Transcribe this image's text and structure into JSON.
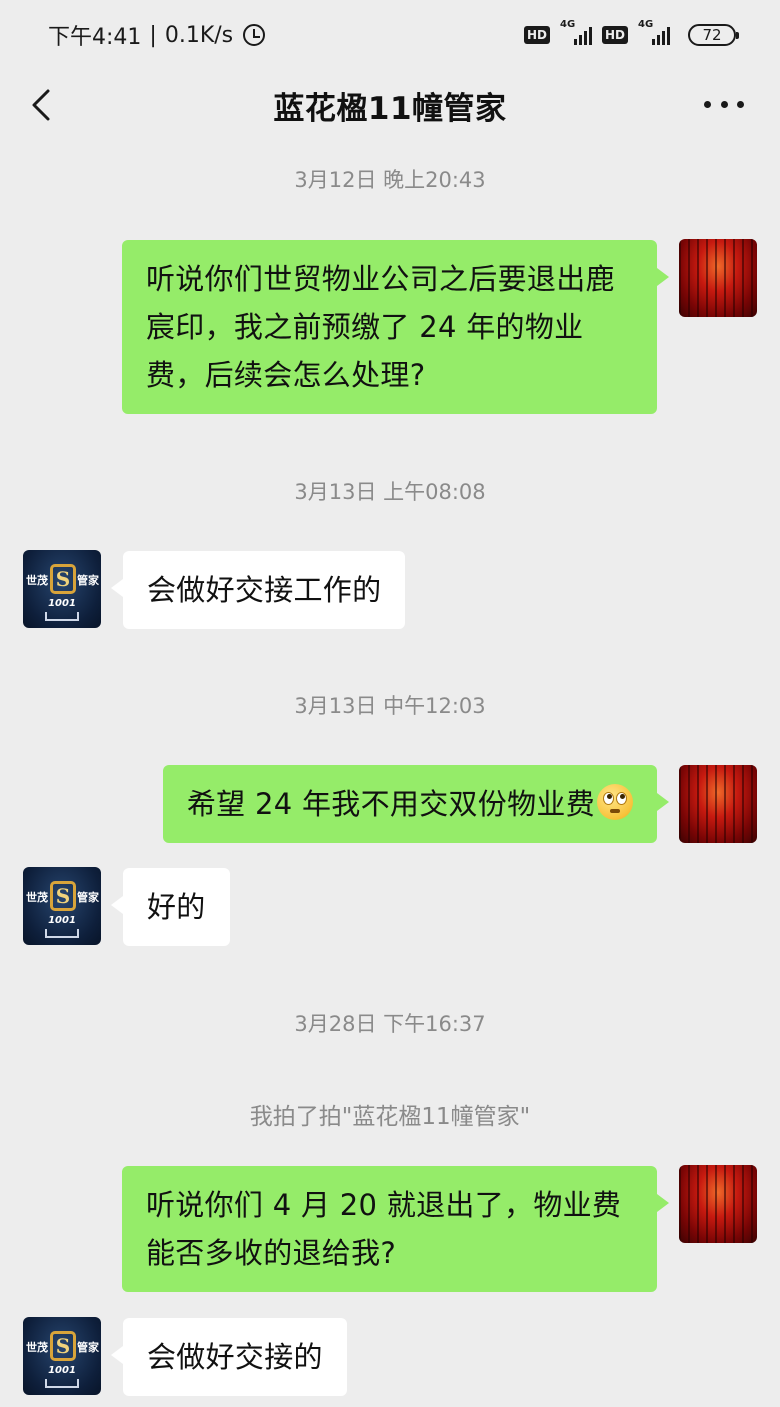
{
  "status_bar": {
    "time": "下午4:41",
    "speed": "0.1K/s",
    "hd1": "HD",
    "hd2": "HD",
    "net1": "4G",
    "net2": "4G",
    "battery": "72"
  },
  "header": {
    "title": "蓝花楹11幢管家"
  },
  "messages": {
    "ts1": "3月12日 晚上20:43",
    "m1": "听说你们世贸物业公司之后要退出鹿宸印，我之前预缴了 24 年的物业费，后续会怎么处理?",
    "ts2": "3月13日 上午08:08",
    "m2": "会做好交接工作的",
    "ts3": "3月13日 中午12:03",
    "m3": "希望 24 年我不用交双份物业费",
    "m3_emoji": "rolling-eyes-emoji",
    "m4": "好的",
    "ts4": "3月28日 下午16:37",
    "sys1": "我拍了拍\"蓝花楹11幢管家\"",
    "m5": "听说你们 4 月 20 就退出了，物业费能否多收的退给我?",
    "m6": "会做好交接的"
  },
  "other_avatar": {
    "logo_left": "世茂",
    "logo_right": "管家",
    "logo_letter": "S",
    "logo_number": "1001"
  },
  "colors": {
    "background": "#ededed",
    "self_bubble": "#95ec69",
    "other_bubble": "#ffffff",
    "timestamp": "#8a8a8a"
  }
}
